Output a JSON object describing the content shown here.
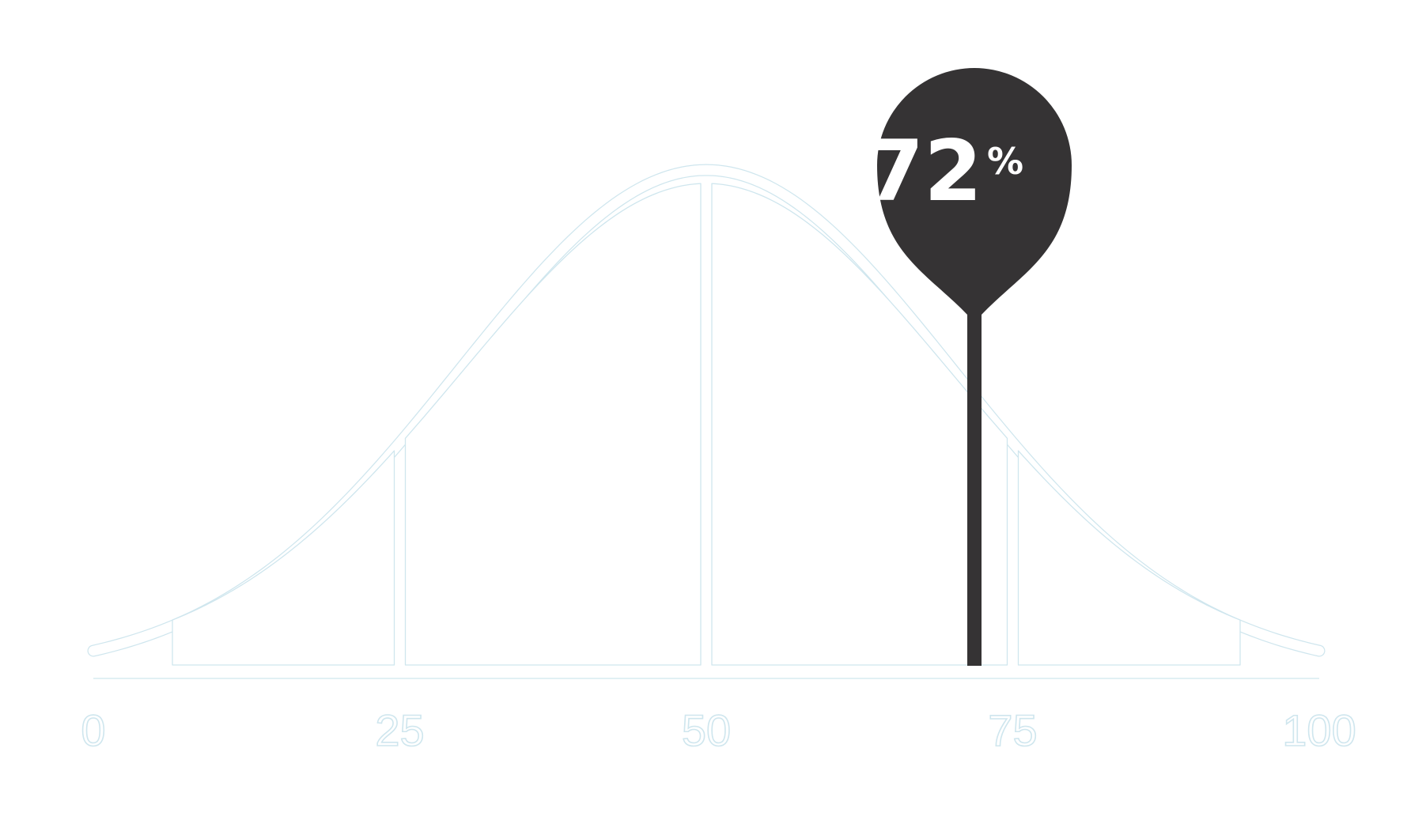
{
  "chart_data": {
    "type": "area",
    "title": "",
    "xlabel": "",
    "ylabel": "",
    "xlim": [
      0,
      100
    ],
    "x_ticks": [
      {
        "value": 0,
        "label": "0"
      },
      {
        "value": 25,
        "label": "25"
      },
      {
        "value": 50,
        "label": "50"
      },
      {
        "value": 75,
        "label": "75"
      },
      {
        "value": 100,
        "label": "100"
      }
    ],
    "distribution": "normal",
    "mean": 50,
    "segment_dividers": [
      25,
      50,
      75
    ],
    "grid": false,
    "legend": "none",
    "marker": {
      "value": 72,
      "value_label": "72",
      "unit": "%"
    },
    "colors": {
      "curve_outline": "#cfe6ee",
      "marker": "#353334",
      "marker_text": "#ffffff",
      "tick_label_outline": "#cfe6ee"
    }
  }
}
